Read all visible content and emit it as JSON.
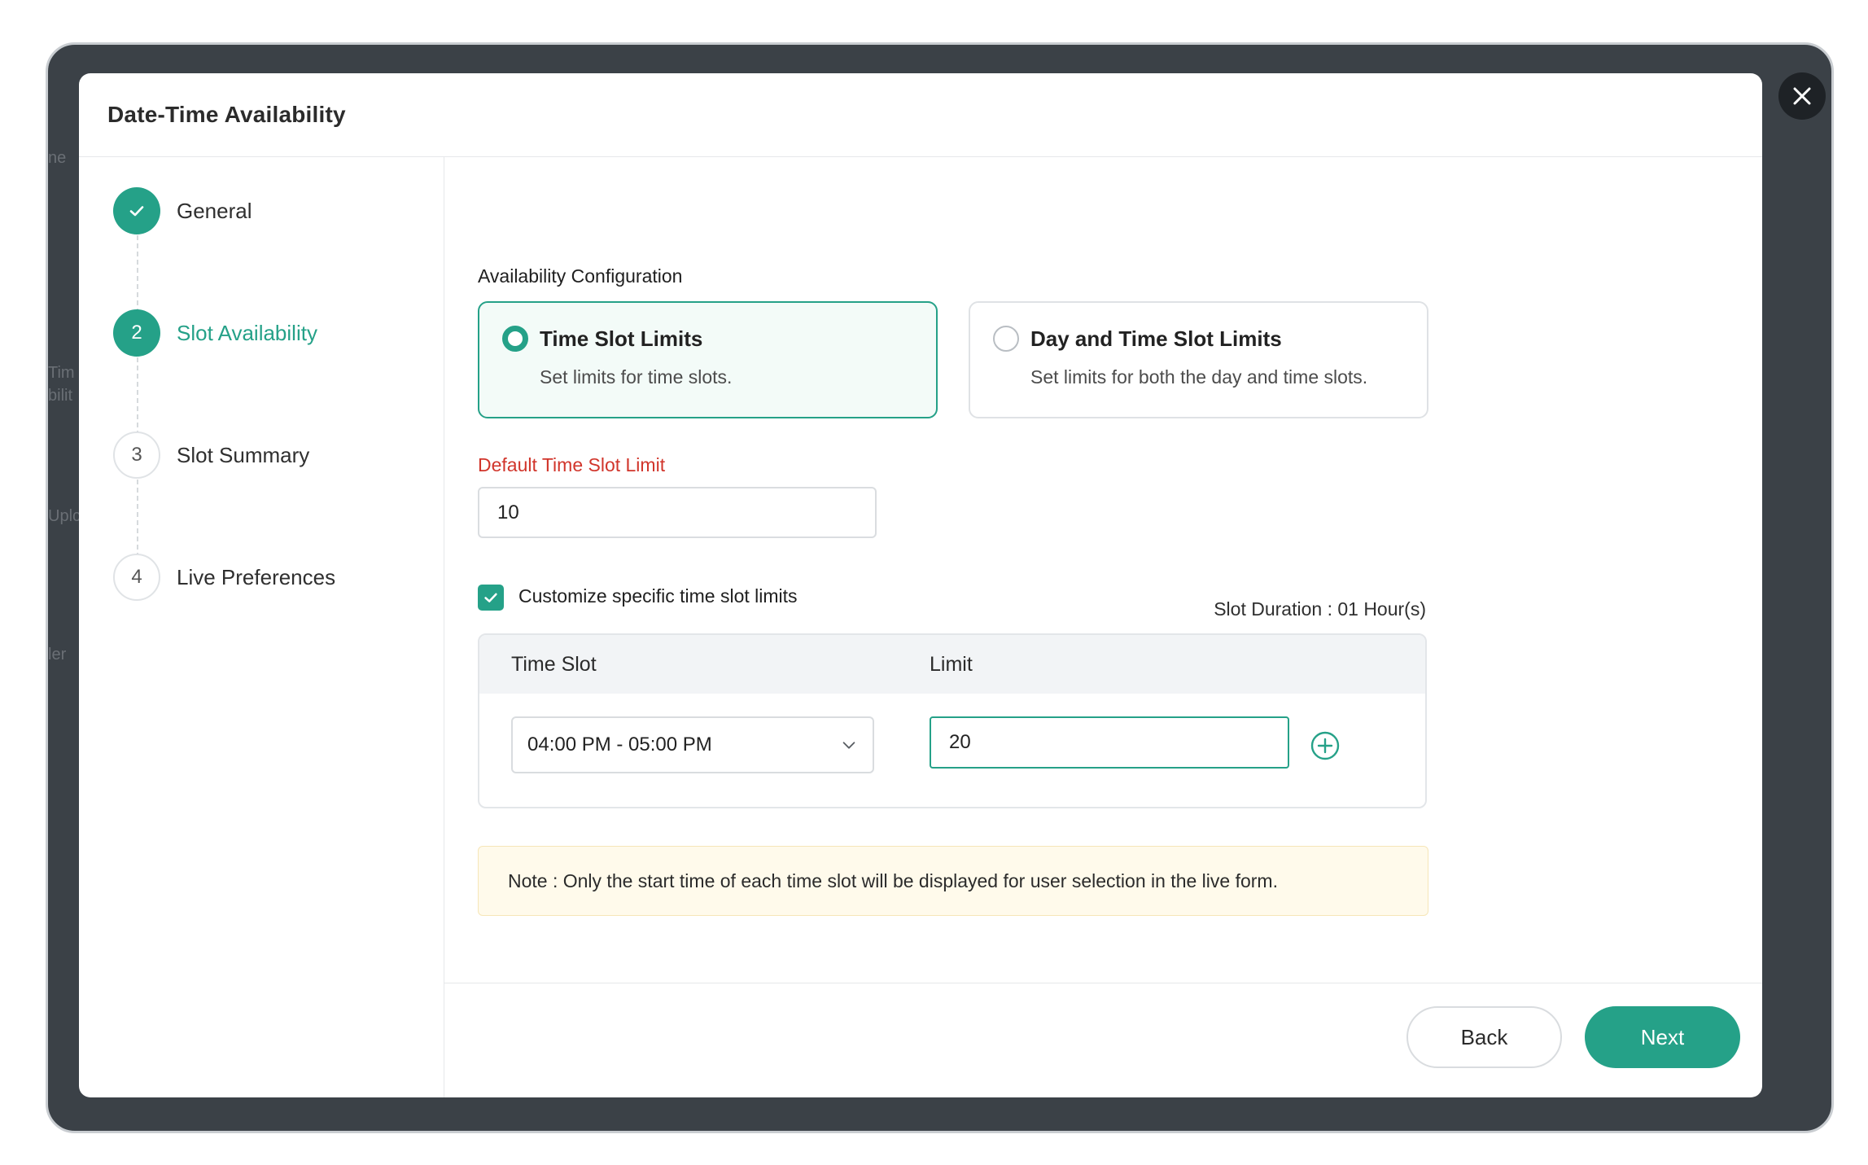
{
  "background_fragments": [
    "ne",
    "Tim",
    "bilit",
    "Uplc",
    "ler"
  ],
  "modal": {
    "title": "Date-Time Availability",
    "close_icon": "close-icon"
  },
  "steps": [
    {
      "number": "",
      "label": "General",
      "state": "done",
      "icon": "check-icon"
    },
    {
      "number": "2",
      "label": "Slot Availability",
      "state": "active"
    },
    {
      "number": "3",
      "label": "Slot Summary",
      "state": "pending"
    },
    {
      "number": "4",
      "label": "Live Preferences",
      "state": "pending"
    }
  ],
  "config": {
    "section_label": "Availability Configuration",
    "options": [
      {
        "title": "Time Slot Limits",
        "description": "Set limits for time slots.",
        "selected": true
      },
      {
        "title": "Day and Time Slot Limits",
        "description": "Set limits for both the day and time slots.",
        "selected": false
      }
    ],
    "default_limit_label": "Default Time Slot Limit",
    "default_limit_value": "10",
    "customize_label": "Customize specific time slot limits",
    "customize_checked": true,
    "slot_duration": "Slot Duration : 01 Hour(s)"
  },
  "table": {
    "headers": [
      "Time Slot",
      "Limit"
    ],
    "rows": [
      {
        "time_slot": "04:00 PM - 05:00 PM",
        "limit": "20"
      }
    ]
  },
  "note": "Note : Only the start time of each time slot will be displayed for user selection in the live form.",
  "footer": {
    "back_label": "Back",
    "next_label": "Next"
  },
  "colors": {
    "accent": "#25a188",
    "required_label": "#d1352b",
    "note_bg": "#fffaeb",
    "backdrop": "#3b4147"
  }
}
